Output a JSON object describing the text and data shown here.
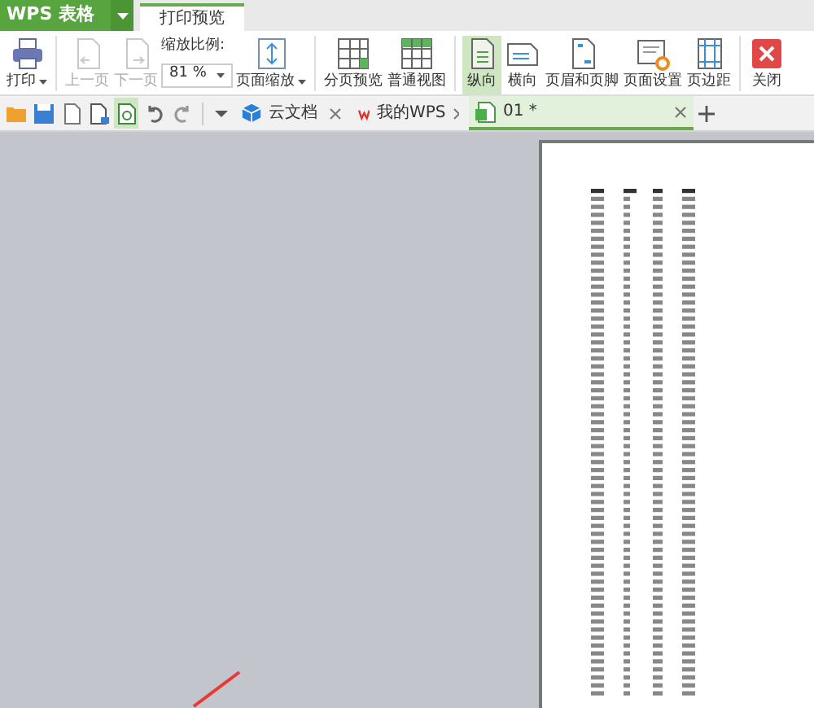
{
  "title_bar": {
    "app_name": "WPS 表格",
    "tabs": [
      {
        "label": "打印预览",
        "selected": true
      }
    ]
  },
  "ribbon": {
    "items": [
      {
        "kind": "button",
        "label": "打印",
        "dropdown": true,
        "disabled": false,
        "selected": false
      },
      {
        "kind": "separator"
      },
      {
        "kind": "button",
        "label": "上一页",
        "dropdown": false,
        "disabled": true,
        "selected": false
      },
      {
        "kind": "button",
        "label": "下一页",
        "dropdown": false,
        "disabled": true,
        "selected": false
      },
      {
        "kind": "zoom",
        "label": "缩放比例:",
        "value": "81 %"
      },
      {
        "kind": "button",
        "label": "页面缩放",
        "dropdown": true,
        "disabled": false,
        "selected": false
      },
      {
        "kind": "separator"
      },
      {
        "kind": "button",
        "label": "分页预览",
        "dropdown": false,
        "disabled": false,
        "selected": false
      },
      {
        "kind": "button",
        "label": "普通视图",
        "dropdown": false,
        "disabled": false,
        "selected": false
      },
      {
        "kind": "separator"
      },
      {
        "kind": "button",
        "label": "纵向",
        "dropdown": false,
        "disabled": false,
        "selected": true
      },
      {
        "kind": "button",
        "label": "横向",
        "dropdown": false,
        "disabled": false,
        "selected": false
      },
      {
        "kind": "button",
        "label": "页眉和页脚",
        "dropdown": false,
        "disabled": false,
        "selected": false
      },
      {
        "kind": "button",
        "label": "页面设置",
        "dropdown": false,
        "disabled": false,
        "selected": false
      },
      {
        "kind": "button",
        "label": "页边距",
        "dropdown": false,
        "disabled": false,
        "selected": false
      },
      {
        "kind": "separator"
      },
      {
        "kind": "button",
        "label": "关闭",
        "dropdown": false,
        "disabled": false,
        "selected": false
      }
    ]
  },
  "quick_access": [
    {
      "selected": false
    },
    {
      "selected": false
    },
    {
      "selected": false
    },
    {
      "selected": false
    },
    {
      "selected": true
    },
    {
      "selected": false
    },
    {
      "selected": false
    }
  ],
  "doc_tabs": [
    {
      "label": "云文档",
      "selected": false
    },
    {
      "label": "我的WPS",
      "selected": false
    },
    {
      "label": "01 *",
      "selected": true
    }
  ]
}
